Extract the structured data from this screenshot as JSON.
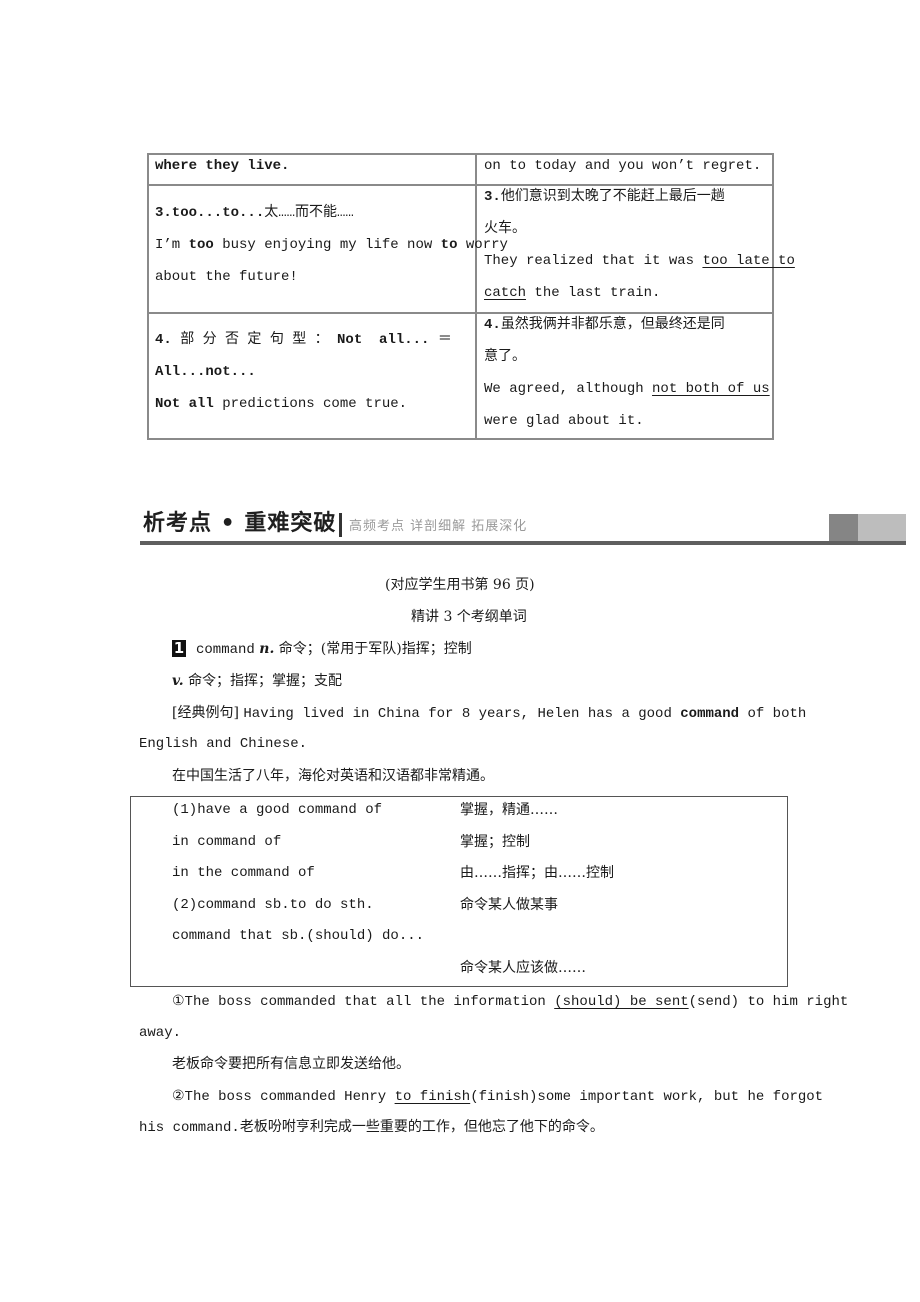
{
  "table": {
    "rows": [
      {
        "left": [
          {
            "segments": [
              {
                "text": "where they live.",
                "bold": true
              }
            ]
          }
        ],
        "right": [
          {
            "segments": [
              {
                "text": "on to today and you won’t regret."
              }
            ]
          }
        ]
      },
      {
        "left": [
          {
            "segments": [
              {
                "text": "3.too...to...",
                "bold": true
              },
              {
                "text": "太……而不能……"
              }
            ]
          },
          {
            "segments": [
              {
                "text": "I’m "
              },
              {
                "text": "too",
                "bold": true
              },
              {
                "text": " busy enjoying my life now "
              },
              {
                "text": "to",
                "bold": true
              },
              {
                "text": " worry"
              }
            ]
          },
          {
            "segments": [
              {
                "text": "about the future!"
              }
            ]
          }
        ],
        "right": [
          {
            "segments": [
              {
                "text": "3.",
                "bold": true
              },
              {
                "text": "他们意识到太晚了不能赶上最后一趟"
              }
            ]
          },
          {
            "segments": [
              {
                "text": "火车。"
              }
            ]
          },
          {
            "segments": [
              {
                "text": "They realized that it was "
              },
              {
                "text": "too late to",
                "underline": true
              }
            ]
          },
          {
            "segments": [
              {
                "text": "catch",
                "underline": true
              },
              {
                "text": " the last train."
              }
            ]
          }
        ]
      },
      {
        "left": [
          {
            "segments": [
              {
                "text": "4. ",
                "bold": true
              },
              {
                "text": "部 分 否 定 句 型 ： "
              },
              {
                "text": "Not  all... ",
                "bold": true
              },
              {
                "text": "＝"
              }
            ]
          },
          {
            "segments": [
              {
                "text": "All...not...",
                "bold": true
              }
            ]
          },
          {
            "segments": [
              {
                "text": "Not all",
                "bold": true
              },
              {
                "text": " predictions come true."
              }
            ]
          }
        ],
        "right": [
          {
            "segments": [
              {
                "text": "4.",
                "bold": true
              },
              {
                "text": "虽然我俩并非都乐意，但最终还是同"
              }
            ]
          },
          {
            "segments": [
              {
                "text": "意了。"
              }
            ]
          },
          {
            "segments": [
              {
                "text": "We agreed, although "
              },
              {
                "text": "not both of us",
                "underline": true
              }
            ]
          },
          {
            "segments": [
              {
                "text": "were glad about it."
              }
            ]
          }
        ]
      }
    ]
  },
  "section": {
    "title": "析考点 • 重难突破",
    "subtitle": "高频考点  详剖细解  拓展深化"
  },
  "intro": {
    "page_ref": "(对应学生用书第 96 页)",
    "heading": "精讲 3 个考纲单词"
  },
  "entry": {
    "number": "1",
    "word": "command",
    "pos_n": "n.",
    "meaning_n": "命令；(常用于军队)指挥；控制",
    "pos_v": "v.",
    "meaning_v": "命令；指挥；掌握；支配"
  },
  "example": {
    "tag": "[经典例句]",
    "line1_before": "Having lived in China for 8 years, Helen has a good ",
    "line1_bold": "command",
    "line1_after": " of both",
    "line2": "English and Chinese.",
    "translation": "在中国生活了八年，海伦对英语和汉语都非常精通。"
  },
  "phrases": [
    {
      "en": "(1)have a good command of",
      "zh": "掌握，精通……"
    },
    {
      "en": "in command of",
      "zh": "掌握；控制"
    },
    {
      "en": "in the command of",
      "zh": "由……指挥；由……控制"
    },
    {
      "en": "(2)command sb.to do sth.",
      "zh": "命令某人做某事"
    },
    {
      "en": "command that sb.(should) do...",
      "zh": ""
    },
    {
      "en": "",
      "zh": "命令某人应该做……"
    }
  ],
  "exercises": [
    {
      "line1_before": "①The boss commanded that all the information ",
      "line1_answer": "(should) be sent",
      "line1_after": "(send) to him right",
      "line2": "away.",
      "translation": "老板命令要把所有信息立即发送给他。"
    },
    {
      "line1_before": "②The boss commanded Henry ",
      "line1_answer": "to finish",
      "line1_after": "(finish)some important work, but he forgot",
      "line2": "his command.老板吩咐亨利完成一些重要的工作，但他忘了他下的命令。"
    }
  ]
}
